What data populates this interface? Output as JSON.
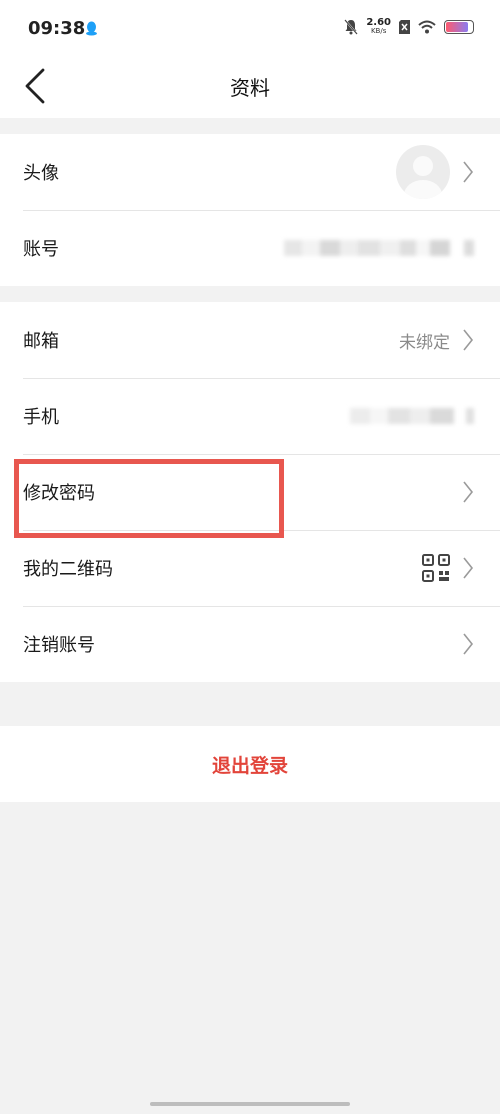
{
  "status_bar": {
    "time": "09:38",
    "net_speed_value": "2.60",
    "net_speed_unit": "KB/s",
    "battery_level": 0.85
  },
  "nav": {
    "title": "资料"
  },
  "profile_group": {
    "avatar_label": "头像",
    "account_label": "账号"
  },
  "contact_group": {
    "email_label": "邮箱",
    "email_value": "未绑定",
    "phone_label": "手机",
    "change_password_label": "修改密码",
    "qrcode_label": "我的二维码",
    "delete_account_label": "注销账号"
  },
  "logout": {
    "label": "退出登录"
  },
  "colors": {
    "accent_red": "#e2443a",
    "highlight_red": "#e8574f",
    "background": "#f2f2f2"
  }
}
